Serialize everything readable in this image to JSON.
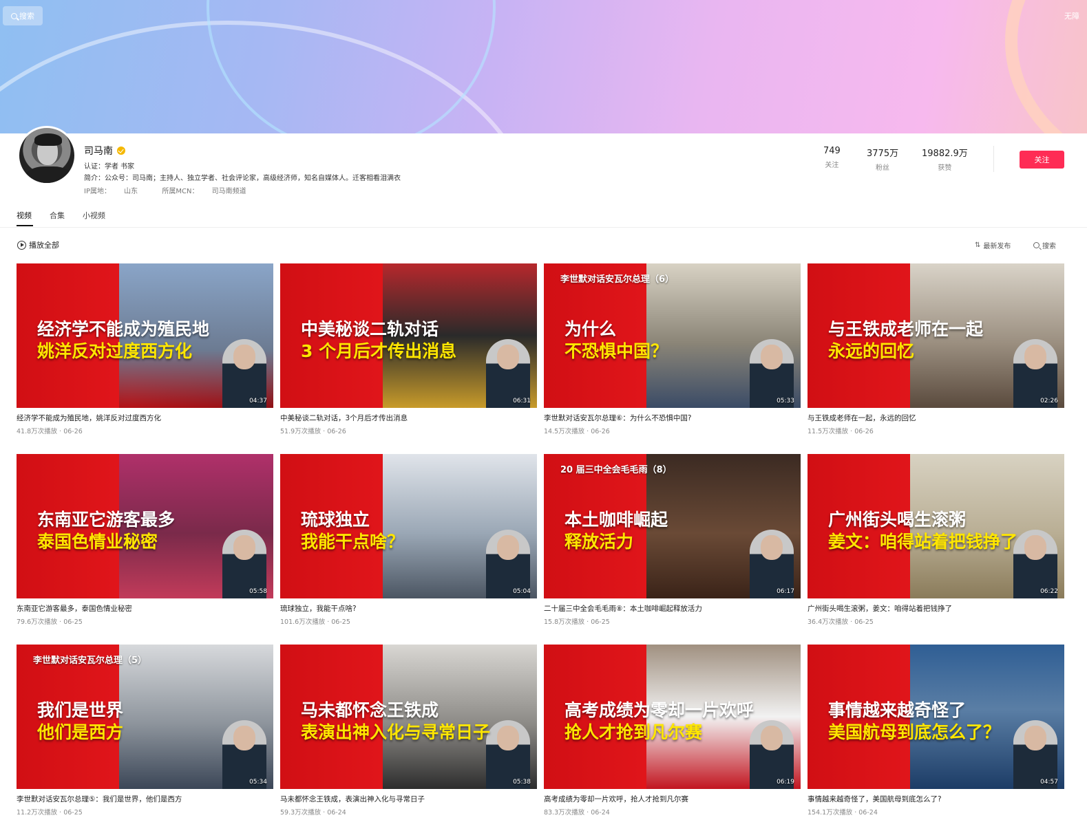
{
  "header": {
    "search_label": "搜索",
    "top_right_text": "无障"
  },
  "profile": {
    "name": "司马南",
    "certification_label": "认证：",
    "certification_value": "学者 书家",
    "bio_label": "简介：",
    "bio_value": "公众号：司马南；主持人、独立学者、社会评论家，高级经济师，知名自媒体人。迁客相看泪满衣",
    "ip_label": "IP属地：",
    "ip_value": "山东",
    "mcn_label": "所属MCN：",
    "mcn_value": "司马南频道",
    "stats": [
      {
        "num": "749",
        "label": "关注"
      },
      {
        "num": "3775万",
        "label": "粉丝"
      },
      {
        "num": "19882.9万",
        "label": "获赞"
      }
    ],
    "follow_label": "关注"
  },
  "tabs": [
    {
      "label": "视频"
    },
    {
      "label": "合集"
    },
    {
      "label": "小视频"
    }
  ],
  "toolbar": {
    "play_all": "播放全部",
    "sort_label": "最新发布",
    "search_label": "搜索"
  },
  "videos": [
    {
      "kicker": "",
      "line1": "经济学不能成为殖民地",
      "line2": "姚洋反对过度西方化",
      "duration": "04:37",
      "title": "经济学不能成为殖民地，姚洋反对过度西方化",
      "stats": "41.8万次播放 · 06-26"
    },
    {
      "kicker": "",
      "line1": "中美秘谈二轨对话",
      "line2": "3 个月后才传出消息",
      "duration": "06:31",
      "title": "中美秘谈二轨对话，3个月后才传出消息",
      "stats": "51.9万次播放 · 06-26"
    },
    {
      "kicker": "李世默对话安瓦尔总理（6）",
      "line1": "为什么",
      "line2": "不恐惧中国？",
      "duration": "05:33",
      "title": "李世默对话安瓦尔总理⑥：为什么不恐惧中国?",
      "stats": "14.5万次播放 · 06-26"
    },
    {
      "kicker": "",
      "line1": "与王铁成老师在一起",
      "line2": "永远的回忆",
      "duration": "02:26",
      "title": "与王铁成老师在一起，永远的回忆",
      "stats": "11.5万次播放 · 06-26"
    },
    {
      "kicker": "",
      "line1": "东南亚它游客最多",
      "line2": "泰国色情业秘密",
      "duration": "05:58",
      "title": "东南亚它游客最多，泰国色情业秘密",
      "stats": "79.6万次播放 · 06-25"
    },
    {
      "kicker": "",
      "line1": "琉球独立",
      "line2": "我能干点啥？",
      "duration": "05:04",
      "title": "琉球独立，我能干点啥?",
      "stats": "101.6万次播放 · 06-25"
    },
    {
      "kicker": "20 届三中全会毛毛雨（8）",
      "line1": "本土咖啡崛起",
      "line2": "释放活力",
      "duration": "06:17",
      "title": "二十届三中全会毛毛雨⑧：本土咖啡崛起释放活力",
      "stats": "15.8万次播放 · 06-25"
    },
    {
      "kicker": "",
      "line1": "广州街头喝生滚粥",
      "line2": "姜文：咱得站着把钱挣了",
      "duration": "06:22",
      "title": "广州街头喝生滚粥，姜文：咱得站着把钱挣了",
      "stats": "36.4万次播放 · 06-25"
    },
    {
      "kicker": "李世默对话安瓦尔总理（5）",
      "line1": "我们是世界",
      "line2": "他们是西方",
      "duration": "05:34",
      "title": "李世默对话安瓦尔总理⑤：我们是世界，他们是西方",
      "stats": "11.2万次播放 · 06-25"
    },
    {
      "kicker": "",
      "line1": "马未都怀念王铁成",
      "line2": "表演出神入化与寻常日子",
      "duration": "05:38",
      "title": "马未都怀念王铁成，表演出神入化与寻常日子",
      "stats": "59.3万次播放 · 06-24"
    },
    {
      "kicker": "",
      "line1": "高考成绩为零却一片欢呼",
      "line2": "抢人才抢到凡尔赛",
      "duration": "06:19",
      "title": "高考成绩为零却一片欢呼，抢人才抢到凡尔赛",
      "stats": "83.3万次播放 · 06-24"
    },
    {
      "kicker": "",
      "line1": "事情越来越奇怪了",
      "line2": "美国航母到底怎么了？",
      "duration": "04:57",
      "title": "事情越来越奇怪了，美国航母到底怎么了?",
      "stats": "154.1万次播放 · 06-24"
    }
  ]
}
